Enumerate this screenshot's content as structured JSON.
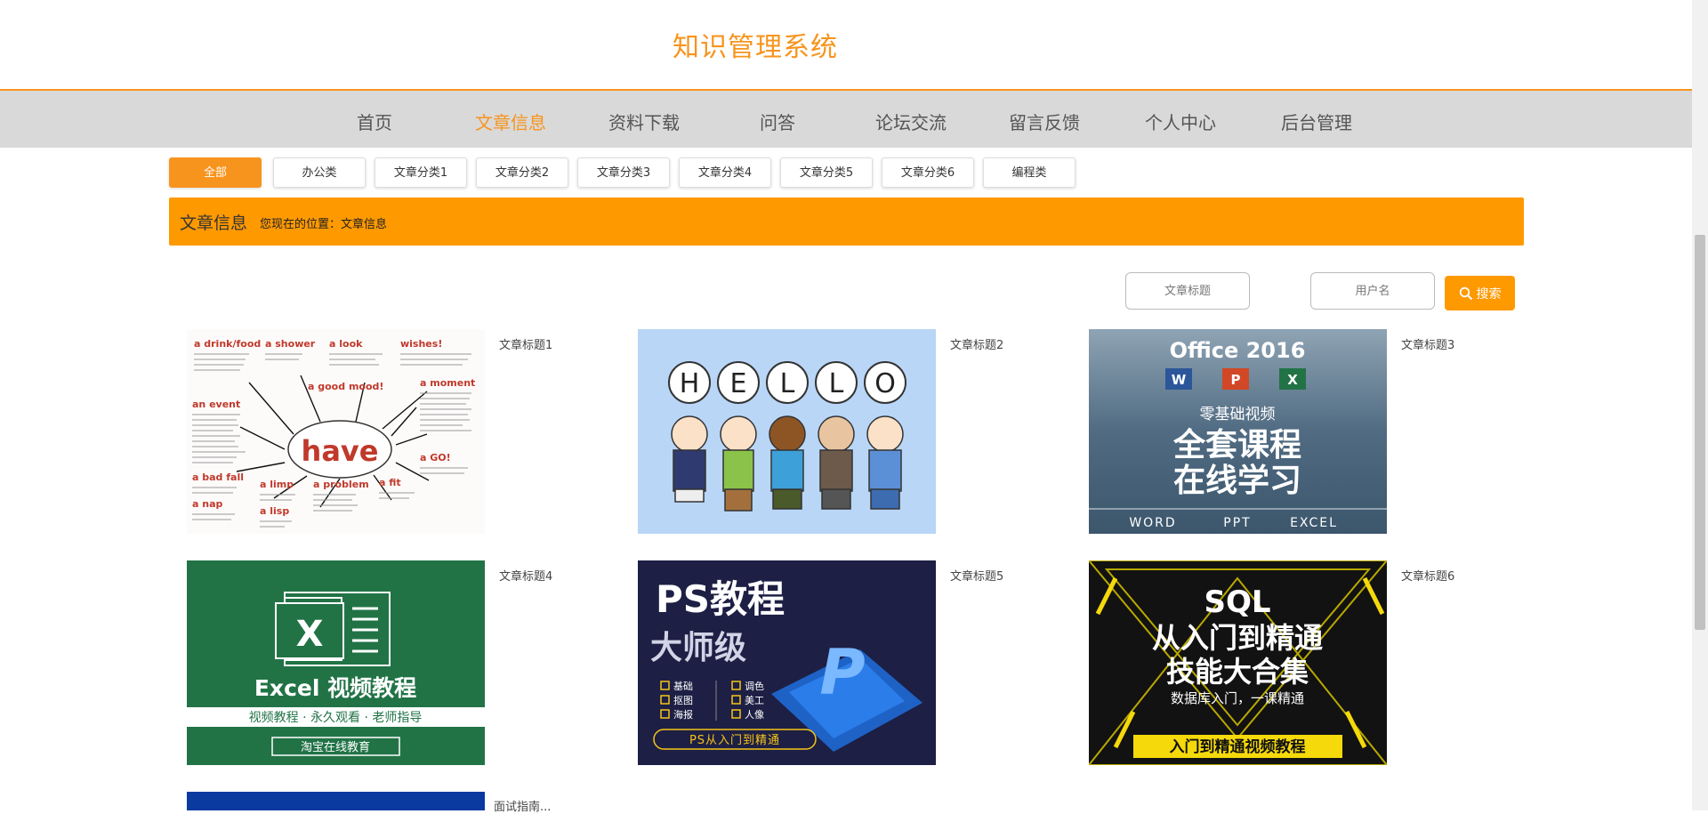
{
  "header": {
    "title": "知识管理系统"
  },
  "nav": {
    "items": [
      {
        "label": "首页"
      },
      {
        "label": "文章信息"
      },
      {
        "label": "资料下载"
      },
      {
        "label": "问答"
      },
      {
        "label": "论坛交流"
      },
      {
        "label": "留言反馈"
      },
      {
        "label": "个人中心"
      },
      {
        "label": "后台管理"
      }
    ],
    "active": "文章信息"
  },
  "categories": {
    "items": [
      {
        "label": "全部"
      },
      {
        "label": "办公类"
      },
      {
        "label": "文章分类1"
      },
      {
        "label": "文章分类2"
      },
      {
        "label": "文章分类3"
      },
      {
        "label": "文章分类4"
      },
      {
        "label": "文章分类5"
      },
      {
        "label": "文章分类6"
      },
      {
        "label": "编程类"
      }
    ],
    "active": "全部"
  },
  "location": {
    "title": "文章信息",
    "text": "您现在的位置：文章信息"
  },
  "search": {
    "title_placeholder": "文章标题",
    "user_placeholder": "用户名",
    "button_label": "搜索"
  },
  "articles": [
    {
      "title": "文章标题1",
      "thumbnail": {
        "center_word": "have",
        "words": [
          "a drink/food",
          "a shower",
          "a look",
          "wishes!",
          "a good mood!",
          "a moment",
          "an event",
          "a bad fall",
          "a limp",
          "a problem",
          "a fit",
          "a GO!",
          "a nap",
          "a lisp"
        ]
      }
    },
    {
      "title": "文章标题2",
      "thumbnail": {
        "letters": [
          "H",
          "E",
          "L",
          "L",
          "O"
        ]
      }
    },
    {
      "title": "文章标题3",
      "thumbnail": {
        "line1": "Office 2016",
        "line2": "零基础视频",
        "line3": "全套课程",
        "line4": "在线学习",
        "apps": [
          "W",
          "P",
          "X"
        ],
        "footer": [
          "WORD",
          "PPT",
          "EXCEL"
        ]
      }
    },
    {
      "title": "文章标题4",
      "thumbnail": {
        "logo": "X",
        "line1": "Excel 视频教程",
        "line2": "视频教程 · 永久观看 · 老师指导",
        "line3": "淘宝在线教育"
      }
    },
    {
      "title": "文章标题5",
      "thumbnail": {
        "line1": "PS教程",
        "line2": "大师级",
        "items": [
          "基础",
          "调色",
          "抠图",
          "美工",
          "海报",
          "人像"
        ],
        "footer": "PS从入门到精通"
      }
    },
    {
      "title": "文章标题6",
      "thumbnail": {
        "line1": "SQL",
        "line2": "从入门到精通",
        "line3": "技能大合集",
        "line4": "数据库入门，一课精通",
        "footer": "入门到精通视频教程"
      }
    },
    {
      "title": "面试指南..."
    }
  ],
  "colors": {
    "accent": "#f7941d",
    "bar": "#ff9900",
    "nav_bg": "#d9d9d9"
  }
}
